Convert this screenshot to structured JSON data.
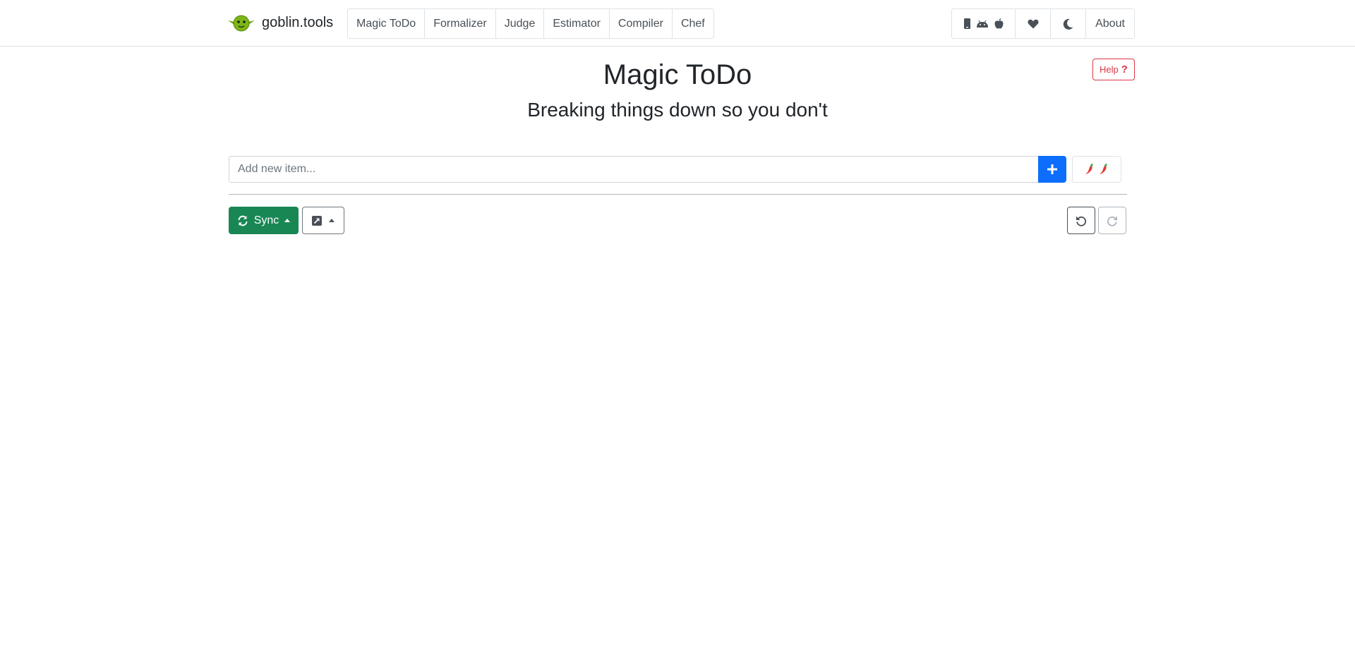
{
  "brand": {
    "name": "goblin.tools",
    "logo_icon": "goblin-head-icon",
    "logo_color": "#7cb518"
  },
  "tools_nav": [
    {
      "label": "Magic ToDo"
    },
    {
      "label": "Formalizer"
    },
    {
      "label": "Judge"
    },
    {
      "label": "Estimator"
    },
    {
      "label": "Compiler"
    },
    {
      "label": "Chef"
    }
  ],
  "right_nav": {
    "platform_icons": [
      "mobile-phone-icon",
      "android-icon",
      "apple-icon"
    ],
    "support_icon": "heart-icon",
    "theme_icon": "moon-icon",
    "about_label": "About"
  },
  "help": {
    "label": "Help",
    "icon": "question-icon"
  },
  "page": {
    "title": "Magic ToDo",
    "subtitle": "Breaking things down so you don't"
  },
  "new_item": {
    "placeholder": "Add new item...",
    "value": "",
    "add_icon": "plus-icon",
    "spiciness_icon": "chili-pepper-icon"
  },
  "toolbar": {
    "sync_label": "Sync",
    "sync_icon": "sync-icon",
    "export_icon": "share-square-icon",
    "undo_icon": "undo-icon",
    "redo_icon": "redo-icon"
  },
  "colors": {
    "primary": "#0d6efd",
    "success": "#198754",
    "danger": "#dc3545",
    "border": "#dee2e6"
  }
}
